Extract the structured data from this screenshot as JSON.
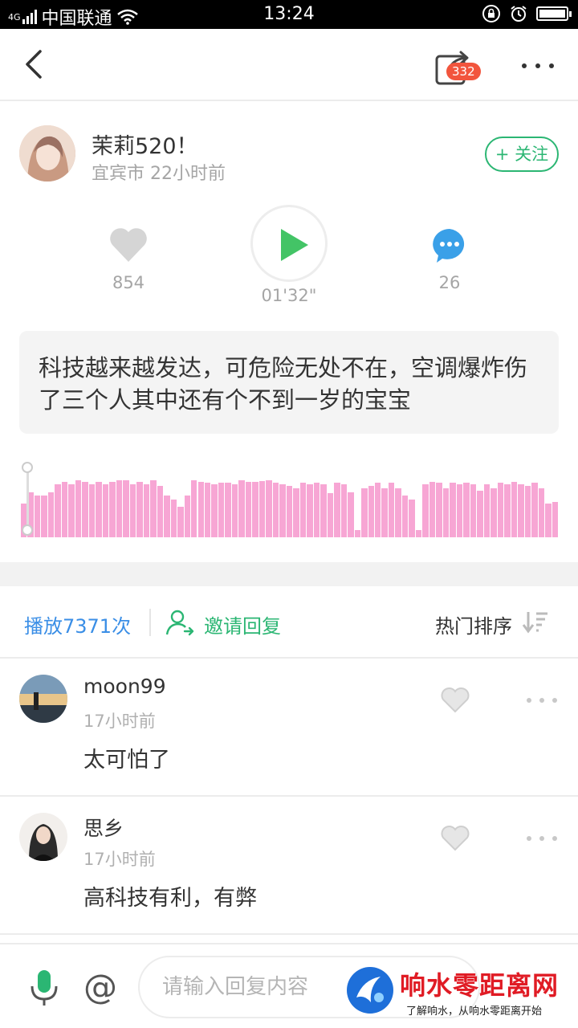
{
  "status_bar": {
    "network": "4G",
    "carrier": "中国联通",
    "time": "13:24"
  },
  "header": {
    "share_count": "332"
  },
  "post": {
    "author": "茉莉520！",
    "meta": "宜宾市 22小时前",
    "follow_label": "+ 关注",
    "like_count": "854",
    "duration": "01'32\"",
    "comment_count": "26",
    "text": "科技越来越发达，可危险无处不在，空调爆炸伤了三个人其中还有个不到一岁的宝宝"
  },
  "waveform": {
    "played_fraction": 0.0,
    "levels": [
      0.45,
      0.6,
      0.55,
      0.55,
      0.6,
      0.7,
      0.73,
      0.7,
      0.75,
      0.73,
      0.7,
      0.73,
      0.7,
      0.73,
      0.75,
      0.76,
      0.7,
      0.73,
      0.7,
      0.75,
      0.68,
      0.55,
      0.5,
      0.4,
      0.55,
      0.75,
      0.73,
      0.72,
      0.7,
      0.72,
      0.72,
      0.7,
      0.75,
      0.73,
      0.73,
      0.74,
      0.75,
      0.72,
      0.7,
      0.68,
      0.65,
      0.72,
      0.7,
      0.72,
      0.7,
      0.58,
      0.72,
      0.7,
      0.6,
      0.1,
      0.65,
      0.68,
      0.72,
      0.65,
      0.72,
      0.65,
      0.55,
      0.5,
      0.1,
      0.7,
      0.73,
      0.72,
      0.65,
      0.72,
      0.7,
      0.72,
      0.7,
      0.62,
      0.7,
      0.65,
      0.72,
      0.7,
      0.73,
      0.7,
      0.68,
      0.72,
      0.65,
      0.45,
      0.47
    ]
  },
  "stats": {
    "play_count": "播放7371次",
    "invite_label": "邀请回复",
    "sort_label": "热门排序"
  },
  "comments": [
    {
      "name": "moon99",
      "time": "17小时前",
      "text": "太可怕了"
    },
    {
      "name": "思乡",
      "time": "17小时前",
      "text": "高科技有利，有弊"
    }
  ],
  "input": {
    "placeholder": "请输入回复内容"
  },
  "watermark": {
    "title": "响水零距离网",
    "subtitle": "了解响水，从响水零距离开始"
  },
  "colors": {
    "accent_green": "#2bb673",
    "link_blue": "#3a8ee6",
    "wave_pink": "#f7a6d4",
    "badge_red": "#f2553d"
  }
}
